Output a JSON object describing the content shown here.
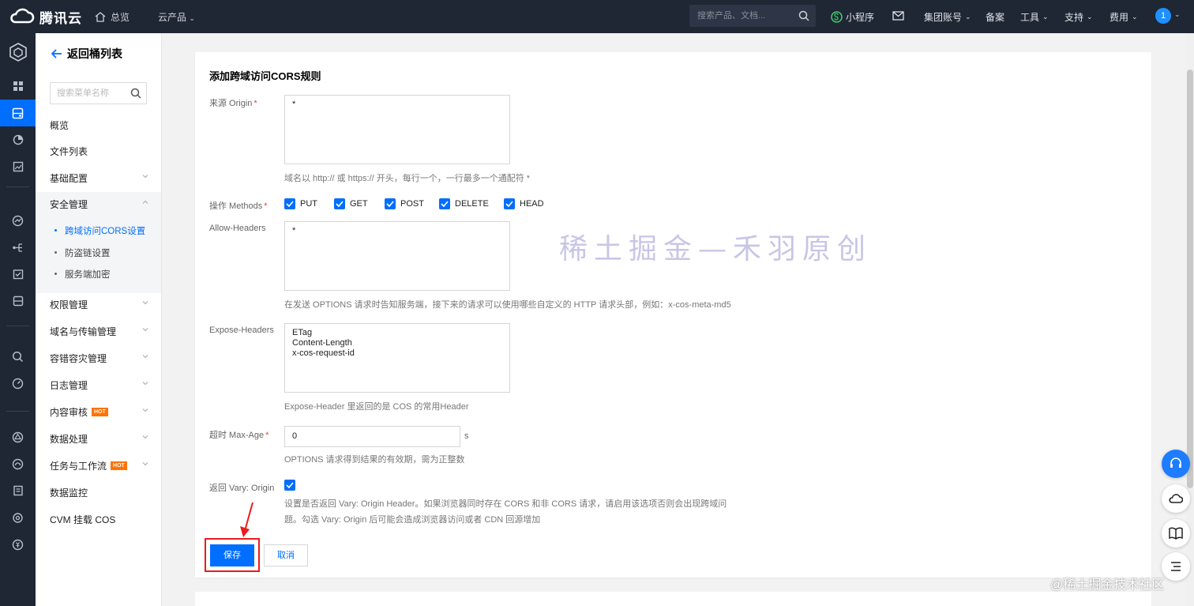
{
  "topbar": {
    "brand": "腾讯云",
    "home": "总览",
    "products": "云产品",
    "search_placeholder": "搜索产品、文档...",
    "mini_program": "小程序",
    "group_account": "集团账号",
    "filing": "备案",
    "tools": "工具",
    "support": "支持",
    "billing": "费用",
    "avatar": "1"
  },
  "sidebar": {
    "back": "返回桶列表",
    "search_placeholder": "搜索菜单名称",
    "items": {
      "overview": "概览",
      "files": "文件列表",
      "basic": "基础配置",
      "security": "安全管理",
      "cors": "跨域访问CORS设置",
      "hotlink": "防盗链设置",
      "encryption": "服务端加密",
      "permission": "权限管理",
      "domain": "域名与传输管理",
      "disaster": "容错容灾管理",
      "logs": "日志管理",
      "audit": "内容审核",
      "processing": "数据处理",
      "workflow": "任务与工作流",
      "monitor": "数据监控",
      "cvm": "CVM 挂载 COS"
    },
    "hot": "HOT"
  },
  "form": {
    "title": "添加跨域访问CORS规则",
    "origin_label": "来源 Origin",
    "origin_value": "*",
    "origin_help": "域名以 http:// 或 https:// 开头，每行一个，一行最多一个通配符 *",
    "methods_label": "操作 Methods",
    "methods": [
      "PUT",
      "GET",
      "POST",
      "DELETE",
      "HEAD"
    ],
    "allow_headers_label": "Allow-Headers",
    "allow_headers_value": "*",
    "allow_headers_help": "在发送 OPTIONS 请求时告知服务端，接下来的请求可以使用哪些自定义的 HTTP 请求头部，例如：x-cos-meta-md5",
    "expose_headers_label": "Expose-Headers",
    "expose_headers_value": "ETag\nContent-Length\nx-cos-request-id",
    "expose_headers_help": "Expose-Header 里返回的是 COS 的常用Header",
    "maxage_label": "超时 Max-Age",
    "maxage_value": "0",
    "maxage_unit": "s",
    "maxage_help": "OPTIONS 请求得到结果的有效期，需为正整数",
    "vary_label": "返回 Vary: Origin",
    "vary_help_1": "设置是否返回 Vary: Origin Header。如果浏览器同时存在 CORS 和非 CORS 请求，请启用该选项否则会出现跨域问",
    "vary_help_2": "题。勾选 Vary: Origin 后可能会造成浏览器访问或者 CDN 回源增加",
    "save": "保存",
    "cancel": "取消"
  },
  "watermark": "稀土掘金—禾羽原创",
  "credit": "@稀土掘金技术社区",
  "colors": {
    "accent": "#006eff",
    "topbar": "#1f2634",
    "highlight": "#e81c1c"
  }
}
